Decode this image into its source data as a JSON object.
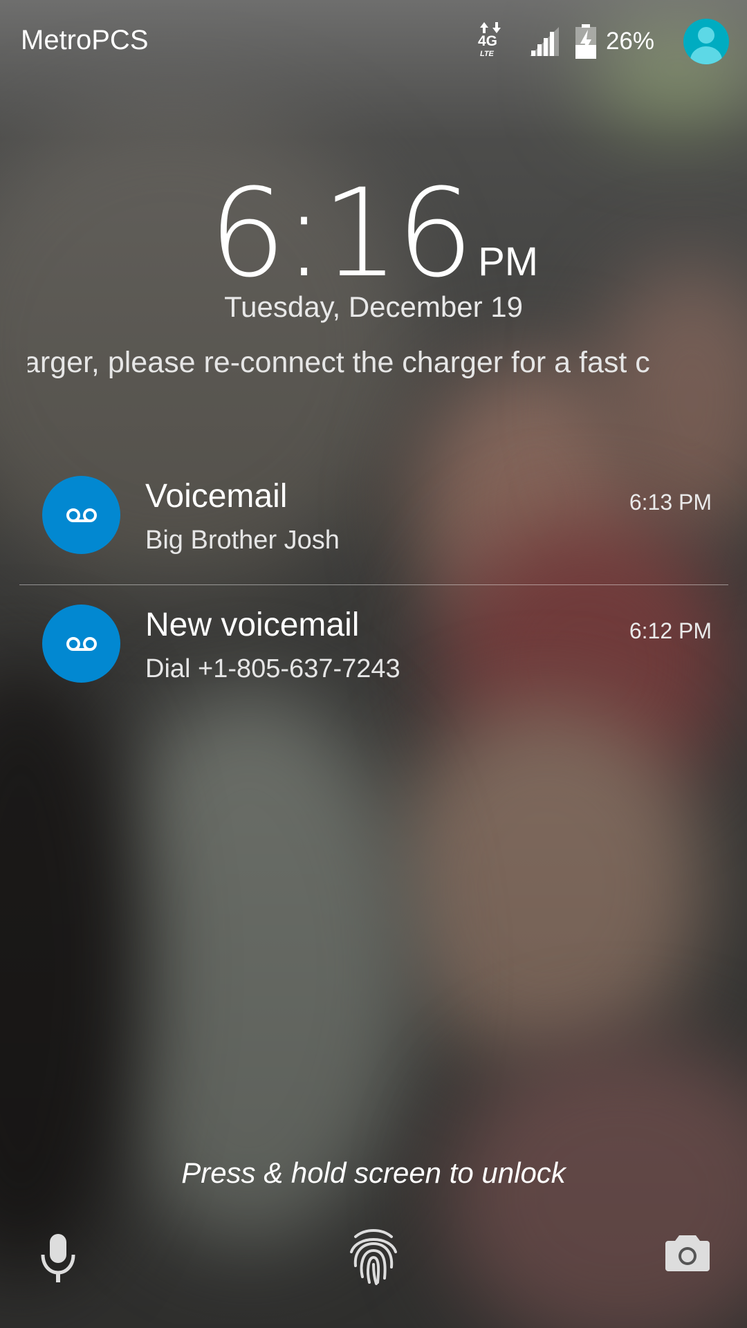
{
  "status_bar": {
    "carrier": "MetroPCS",
    "network_label": "4G",
    "network_sub_label": "LTE",
    "battery_percent": "26%",
    "icons": [
      "network-4g-lte-icon",
      "signal-strength-icon",
      "battery-charging-icon",
      "user-avatar-icon"
    ],
    "avatar_color": "#00acc1"
  },
  "clock": {
    "time": "6:16",
    "ampm": "PM",
    "date": "Tuesday, December 19"
  },
  "marquee": "harger, please re-connect  the charger for a fast c",
  "notifications": [
    {
      "icon": "voicemail-icon",
      "title": "Voicemail",
      "subtitle": "Big Brother Josh",
      "time": "6:13 PM"
    },
    {
      "icon": "voicemail-icon",
      "title": "New voicemail",
      "subtitle": "Dial +1-805-637-7243",
      "time": "6:12 PM"
    }
  ],
  "notification_icon_color": "#0288d1",
  "unlock_hint": "Press & hold screen to unlock",
  "bottom_bar": {
    "icons": [
      "microphone-icon",
      "fingerprint-icon",
      "camera-icon"
    ]
  }
}
